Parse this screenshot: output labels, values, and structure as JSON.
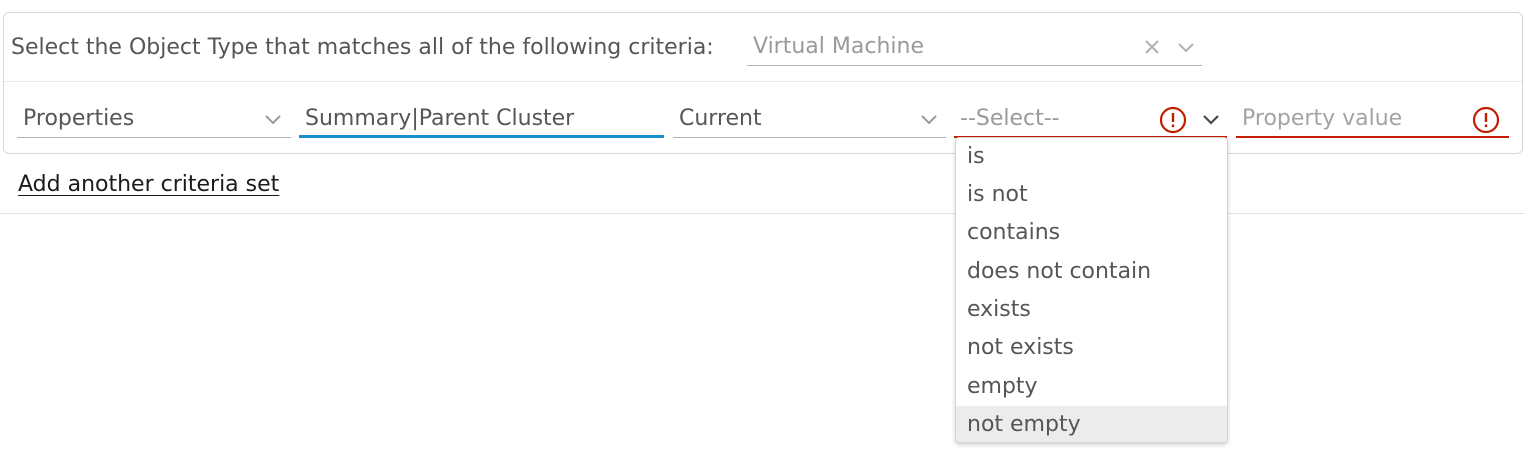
{
  "criteria": {
    "label": "Select the Object Type that matches all of the following criteria:",
    "object_type": {
      "value": "Virtual Machine",
      "clear_icon": "close-icon",
      "dropdown_icon": "chevron-down-icon"
    }
  },
  "condition_row": {
    "category": {
      "value": "Properties",
      "dropdown_icon": "chevron-down-icon"
    },
    "attribute": {
      "value": "Summary|Parent Cluster"
    },
    "instance": {
      "value": "Current",
      "dropdown_icon": "chevron-down-icon"
    },
    "operator": {
      "placeholder": "--Select--",
      "error_icon": "exclamation-circle-icon",
      "dropdown_icon": "chevron-down-icon",
      "options": [
        "is",
        "is not",
        "contains",
        "does not contain",
        "exists",
        "not exists",
        "empty",
        "not empty"
      ],
      "highlighted_option": "not empty"
    },
    "property_value": {
      "placeholder": "Property value",
      "error_icon": "exclamation-circle-icon"
    }
  },
  "add_link": "Add another criteria set",
  "colors": {
    "accent_blue": "#1a8ed2",
    "error_red": "#c21d00",
    "text": "#565656",
    "placeholder": "#9a9a9a",
    "option_highlight": "#ececec"
  }
}
